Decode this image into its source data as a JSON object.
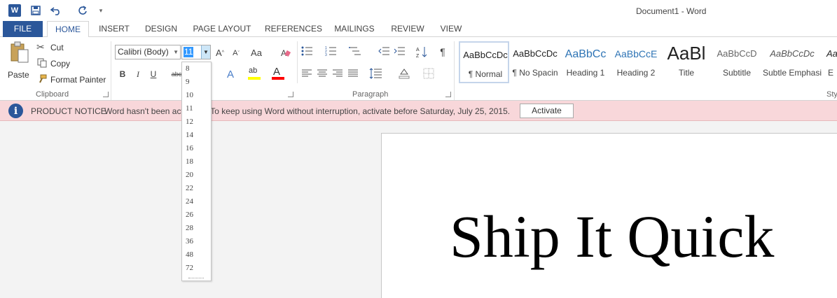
{
  "window": {
    "title": "Document1 - Word"
  },
  "tabs": [
    "FILE",
    "HOME",
    "INSERT",
    "DESIGN",
    "PAGE LAYOUT",
    "REFERENCES",
    "MAILINGS",
    "REVIEW",
    "VIEW"
  ],
  "clipboard": {
    "paste": "Paste",
    "cut": "Cut",
    "copy": "Copy",
    "format_painter": "Format Painter",
    "group": "Clipboard"
  },
  "font": {
    "name": "Calibri (Body)",
    "size": "11",
    "grow": "A",
    "shrink": "A",
    "case": "Aa",
    "bold": "B",
    "italic": "I",
    "underline": "U",
    "strike": "abc",
    "text_effects": "A",
    "highlight": "ab",
    "font_color": "A"
  },
  "paragraph": {
    "group": "Paragraph"
  },
  "styles": {
    "items": [
      {
        "sample": "AaBbCcDc",
        "name": "¶ Normal"
      },
      {
        "sample": "AaBbCcDc",
        "name": "¶ No Spacin"
      },
      {
        "sample": "AaBbCc",
        "name": "Heading 1"
      },
      {
        "sample": "AaBbCcE",
        "name": "Heading 2"
      },
      {
        "sample": "AaBl",
        "name": "Title"
      },
      {
        "sample": "AaBbCcD",
        "name": "Subtitle"
      },
      {
        "sample": "AaBbCcDc",
        "name": "Subtle Emphasi"
      },
      {
        "sample": "AaBbC",
        "name": "E"
      }
    ],
    "group": "Sty"
  },
  "notice": {
    "title": "PRODUCT NOTICE",
    "message": "Word hasn't been activated. To keep using Word without interruption, activate before Saturday, July 25, 2015.",
    "button": "Activate"
  },
  "document": {
    "text": "Ship It Quick"
  },
  "font_size_options": [
    "8",
    "9",
    "10",
    "11",
    "12",
    "14",
    "16",
    "18",
    "20",
    "22",
    "24",
    "26",
    "28",
    "36",
    "48",
    "72"
  ],
  "colors": {
    "accent": "#2b579a",
    "notice_bg": "#f8d7da",
    "highlight": "#ffff00",
    "font_color": "#ff0000"
  }
}
